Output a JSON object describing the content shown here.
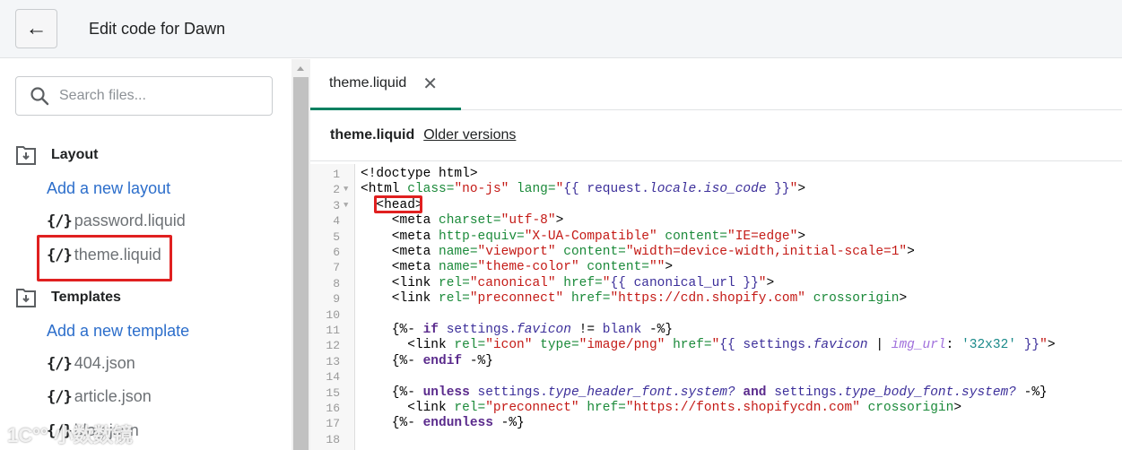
{
  "header": {
    "title": "Edit code for Dawn",
    "back_icon": "arrow-left-icon"
  },
  "sidebar": {
    "search_placeholder": "Search files...",
    "sections": [
      {
        "title": "Layout",
        "add_label": "Add a new layout",
        "files": [
          "password.liquid",
          "theme.liquid"
        ]
      },
      {
        "title": "Templates",
        "add_label": "Add a new template",
        "files": [
          "404.json",
          "article.json",
          "blog.json"
        ]
      }
    ],
    "file_icon_glyph": "{/}",
    "highlighted_file": "theme.liquid"
  },
  "editor": {
    "tab_label": "theme.liquid",
    "file_name": "theme.liquid",
    "older_versions": "Older versions",
    "accent": "#008060",
    "lines": [
      {
        "n": "1",
        "fold": false,
        "indent": 0,
        "tokens": [
          [
            "",
            "<!doctype html>"
          ]
        ]
      },
      {
        "n": "2",
        "fold": true,
        "indent": 0,
        "tokens": [
          [
            "",
            "<html "
          ],
          [
            "attr",
            "class="
          ],
          [
            "str",
            "\"no-js\""
          ],
          [
            "attr",
            " lang="
          ],
          [
            "str",
            "\""
          ],
          [
            "var",
            "{{ request."
          ],
          [
            "it",
            "locale.iso_code"
          ],
          [
            "var",
            " }}"
          ],
          [
            "str",
            "\""
          ],
          [
            "",
            "> "
          ]
        ]
      },
      {
        "n": "3",
        "fold": true,
        "indent": 2,
        "tokens": [
          [
            "",
            "<head>"
          ]
        ]
      },
      {
        "n": "4",
        "fold": false,
        "indent": 4,
        "tokens": [
          [
            "",
            "<meta "
          ],
          [
            "attr",
            "charset="
          ],
          [
            "str",
            "\"utf-8\""
          ],
          [
            "",
            ">"
          ]
        ]
      },
      {
        "n": "5",
        "fold": false,
        "indent": 4,
        "tokens": [
          [
            "",
            "<meta "
          ],
          [
            "attr",
            "http-equiv="
          ],
          [
            "str",
            "\"X-UA-Compatible\""
          ],
          [
            "attr",
            " content="
          ],
          [
            "str",
            "\"IE=edge\""
          ],
          [
            "",
            ">"
          ]
        ]
      },
      {
        "n": "6",
        "fold": false,
        "indent": 4,
        "tokens": [
          [
            "",
            "<meta "
          ],
          [
            "attr",
            "name="
          ],
          [
            "str",
            "\"viewport\""
          ],
          [
            "attr",
            " content="
          ],
          [
            "str",
            "\"width=device-width,initial-scale=1\""
          ],
          [
            "",
            ">"
          ]
        ]
      },
      {
        "n": "7",
        "fold": false,
        "indent": 4,
        "tokens": [
          [
            "",
            "<meta "
          ],
          [
            "attr",
            "name="
          ],
          [
            "str",
            "\"theme-color\""
          ],
          [
            "attr",
            " content="
          ],
          [
            "str",
            "\"\""
          ],
          [
            "",
            ">"
          ]
        ]
      },
      {
        "n": "8",
        "fold": false,
        "indent": 4,
        "tokens": [
          [
            "",
            "<link "
          ],
          [
            "attr",
            "rel="
          ],
          [
            "str",
            "\"canonical\""
          ],
          [
            "attr",
            " href="
          ],
          [
            "str",
            "\""
          ],
          [
            "var",
            "{{ canonical_url }}"
          ],
          [
            "str",
            "\""
          ],
          [
            "",
            ">"
          ]
        ]
      },
      {
        "n": "9",
        "fold": false,
        "indent": 4,
        "tokens": [
          [
            "",
            "<link "
          ],
          [
            "attr",
            "rel="
          ],
          [
            "str",
            "\"preconnect\""
          ],
          [
            "attr",
            " href="
          ],
          [
            "str",
            "\"https://cdn.shopify.com\""
          ],
          [
            "attr",
            " crossorigin"
          ],
          [
            "",
            ">"
          ]
        ]
      },
      {
        "n": "10",
        "fold": false,
        "indent": 0,
        "tokens": []
      },
      {
        "n": "11",
        "fold": false,
        "indent": 4,
        "tokens": [
          [
            "",
            "{%- "
          ],
          [
            "kw",
            "if"
          ],
          [
            "var",
            " settings."
          ],
          [
            "it",
            "favicon"
          ],
          [
            "",
            " != "
          ],
          [
            "var",
            "blank"
          ],
          [
            "",
            " -%}"
          ]
        ]
      },
      {
        "n": "12",
        "fold": false,
        "indent": 6,
        "tokens": [
          [
            "",
            "<link "
          ],
          [
            "attr",
            "rel="
          ],
          [
            "str",
            "\"icon\""
          ],
          [
            "attr",
            " type="
          ],
          [
            "str",
            "\"image/png\""
          ],
          [
            "attr",
            " href="
          ],
          [
            "str",
            "\""
          ],
          [
            "var",
            "{{ settings."
          ],
          [
            "it",
            "favicon"
          ],
          [
            "",
            " | "
          ],
          [
            "flt",
            "img_url"
          ],
          [
            "",
            ": "
          ],
          [
            "lstr",
            "'32x32'"
          ],
          [
            "var",
            " }}"
          ],
          [
            "str",
            "\""
          ],
          [
            "",
            ">"
          ]
        ]
      },
      {
        "n": "13",
        "fold": false,
        "indent": 4,
        "tokens": [
          [
            "",
            "{%- "
          ],
          [
            "kw",
            "endif"
          ],
          [
            "",
            " -%}"
          ]
        ]
      },
      {
        "n": "14",
        "fold": false,
        "indent": 0,
        "tokens": []
      },
      {
        "n": "15",
        "fold": false,
        "indent": 4,
        "tokens": [
          [
            "",
            "{%- "
          ],
          [
            "kw",
            "unless"
          ],
          [
            "var",
            " settings."
          ],
          [
            "it",
            "type_header_font.system?"
          ],
          [
            "kw",
            " and"
          ],
          [
            "var",
            " settings."
          ],
          [
            "it",
            "type_body_font.system?"
          ],
          [
            "",
            " -%}"
          ]
        ]
      },
      {
        "n": "16",
        "fold": false,
        "indent": 6,
        "tokens": [
          [
            "",
            "<link "
          ],
          [
            "attr",
            "rel="
          ],
          [
            "str",
            "\"preconnect\""
          ],
          [
            "attr",
            " href="
          ],
          [
            "str",
            "\"https://fonts.shopifycdn.com\""
          ],
          [
            "attr",
            " crossorigin"
          ],
          [
            "",
            ">"
          ]
        ]
      },
      {
        "n": "17",
        "fold": false,
        "indent": 4,
        "tokens": [
          [
            "",
            "{%- "
          ],
          [
            "kw",
            "endunless"
          ],
          [
            "",
            " -%}"
          ]
        ]
      },
      {
        "n": "18",
        "fold": false,
        "indent": 0,
        "tokens": []
      }
    ]
  }
}
